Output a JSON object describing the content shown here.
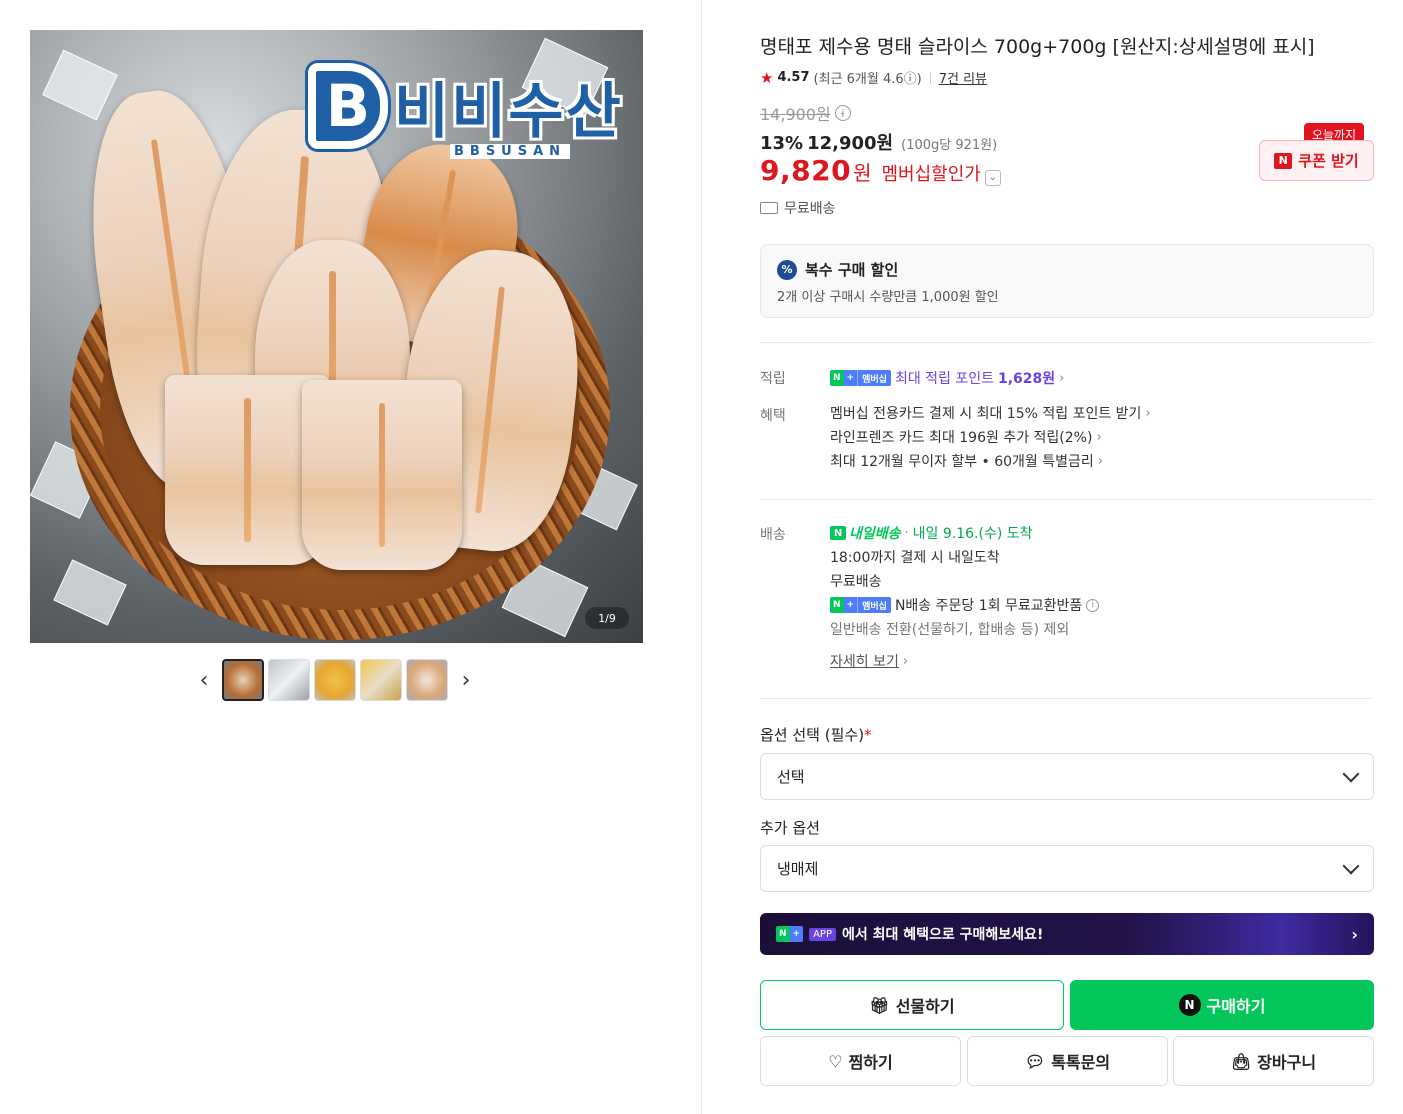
{
  "gallery": {
    "logo_main": "비비수산",
    "logo_sub": "BBSUSAN",
    "counter": "1/9",
    "thumbnails": [
      "thumb-1",
      "thumb-2",
      "thumb-3",
      "thumb-4",
      "thumb-5"
    ]
  },
  "product": {
    "title": "명태포 제수용 명태 슬라이스 700g+700g [원산지:상세설명에 표시]",
    "rating": "4.57",
    "rating_recent": "(최근 6개월 4.6ⓘ)",
    "reviews": "7건 리뷰",
    "original_price": "14,900원",
    "discount_pct": "13%",
    "sale_price": "12,900원",
    "unit_price": "(100g당 921원)",
    "member_price": "9,820",
    "member_won": "원",
    "member_label": "멤버십할인가",
    "coupon_tag": "오늘까지",
    "coupon_label": "쿠폰 받기",
    "free_shipping": "무료배송"
  },
  "multi_discount": {
    "title": "복수 구매 할인",
    "desc": "2개 이상 구매시 수량만큼 1,000원 할인"
  },
  "benefits": {
    "points_label": "적립",
    "points_text": "최대 적립 포인트",
    "points_value": "1,628원",
    "perks_label": "혜택",
    "perks": [
      "멤버십 전용카드 결제 시 최대 15% 적립 포인트 받기",
      "라인프렌즈 카드 최대 196원 추가 적립(2%)",
      "최대 12개월 무이자 할부 • 60개월 특별금리"
    ],
    "badge_n": "N",
    "badge_plus": "+",
    "badge_member": "멤버십"
  },
  "delivery": {
    "label": "배송",
    "n_delivery": "내일배송",
    "arrival": "내일 9.16.(수) 도착",
    "cutoff": "18:00까지 결제 시 내일도착",
    "free": "무료배송",
    "exchange": "N배송 주문당 1회 무료교환반품",
    "exception": "일반배송 전환(선물하기, 합배송 등) 제외",
    "more": "자세히 보기"
  },
  "options": {
    "label1": "옵션 선택 (필수)",
    "required_mark": "*",
    "select1": "선택",
    "label2": "추가 옵션",
    "select2": "냉매제"
  },
  "banner": {
    "app": "APP",
    "text": "에서 최대 혜택으로 구매해보세요!"
  },
  "buttons": {
    "gift": "선물하기",
    "buy": "구매하기",
    "zzim": "찜하기",
    "talk": "톡톡문의",
    "cart": "장바구니"
  },
  "colors": {
    "brand_green": "#03c75a",
    "sale_red": "#e1151f",
    "membership_purple": "#6a43e4"
  }
}
